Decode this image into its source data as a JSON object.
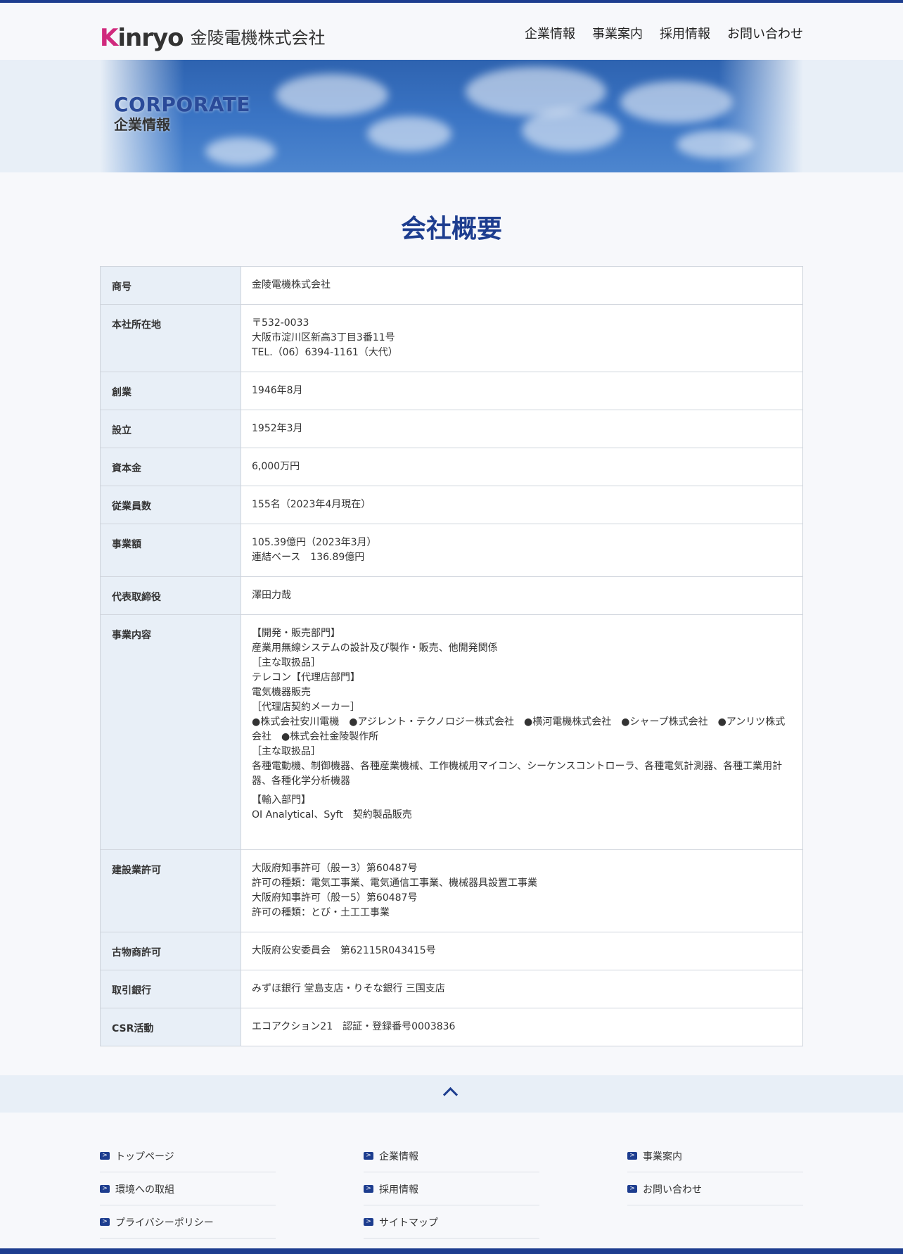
{
  "header": {
    "logo_text": "Kinryo",
    "company_name": "金陵電機株式会社",
    "nav": [
      "企業情報",
      "事業案内",
      "採用情報",
      "お問い合わせ"
    ]
  },
  "banner": {
    "en": "CORPORATE",
    "ja": "企業情報"
  },
  "section_title": "会社概要",
  "overview": [
    {
      "label": "商号",
      "lines": [
        "金陵電機株式会社"
      ]
    },
    {
      "label": "本社所在地",
      "lines": [
        "〒532-0033",
        "大阪市淀川区新高3丁目3番11号",
        "TEL.（06）6394-1161（大代）"
      ]
    },
    {
      "label": "創業",
      "lines": [
        "1946年8月"
      ]
    },
    {
      "label": "設立",
      "lines": [
        "1952年3月"
      ]
    },
    {
      "label": "資本金",
      "lines": [
        "6,000万円"
      ]
    },
    {
      "label": "従業員数",
      "lines": [
        "155名（2023年4月現在）"
      ]
    },
    {
      "label": "事業額",
      "lines": [
        "105.39億円（2023年3月）",
        "連結ベース　136.89億円"
      ]
    },
    {
      "label": "代表取締役",
      "lines": [
        "澤田力哉"
      ]
    },
    {
      "label": "事業内容",
      "lines": [
        "【開発・販売部門】",
        "産業用無線システムの設計及び製作・販売、他開発関係",
        "［主な取扱品］",
        "テレコン【代理店部門】",
        "電気機器販売",
        "［代理店契約メーカー］",
        "●株式会社安川電機　●アジレント・テクノロジー株式会社　●横河電機株式会社　●シャープ株式会社　●アンリツ株式会社　●株式会社金陵製作所",
        "［主な取扱品］",
        "各種電動機、制御機器、各種産業機械、工作機械用マイコン、シーケンスコントローラ、各種電気計測器、各種工業用計器、各種化学分析機器",
        "",
        "【輸入部門】",
        "OI Analytical、Syft　契約製品販売"
      ]
    },
    {
      "label": "建設業許可",
      "lines": [
        "大阪府知事許可（般ー3）第60487号",
        "許可の種類：電気工事業、電気通信工事業、機械器具設置工事業",
        "大阪府知事許可（般ー5）第60487号",
        "許可の種類：とび・土工工事業"
      ]
    },
    {
      "label": "古物商許可",
      "lines": [
        "大阪府公安委員会　第62115R043415号"
      ]
    },
    {
      "label": "取引銀行",
      "lines": [
        "みずほ銀行 堂島支店・りそな銀行 三国支店"
      ]
    },
    {
      "label": "CSR活動",
      "lines": [
        "エコアクション21　認証・登録番号0003836"
      ]
    }
  ],
  "footer": {
    "columns": [
      [
        "トップページ",
        "環境への取組",
        "プライバシーポリシー"
      ],
      [
        "企業情報",
        "採用情報",
        "サイトマップ"
      ],
      [
        "事業案内",
        "お問い合わせ"
      ]
    ]
  },
  "colors": {
    "brand_blue": "#1d3d8f",
    "logo_pink": "#d02a7d",
    "table_header_bg": "#e8eff7"
  },
  "icons": {
    "back_to_top": "chevron-up-icon",
    "footer_link": "chevron-right-icon"
  }
}
